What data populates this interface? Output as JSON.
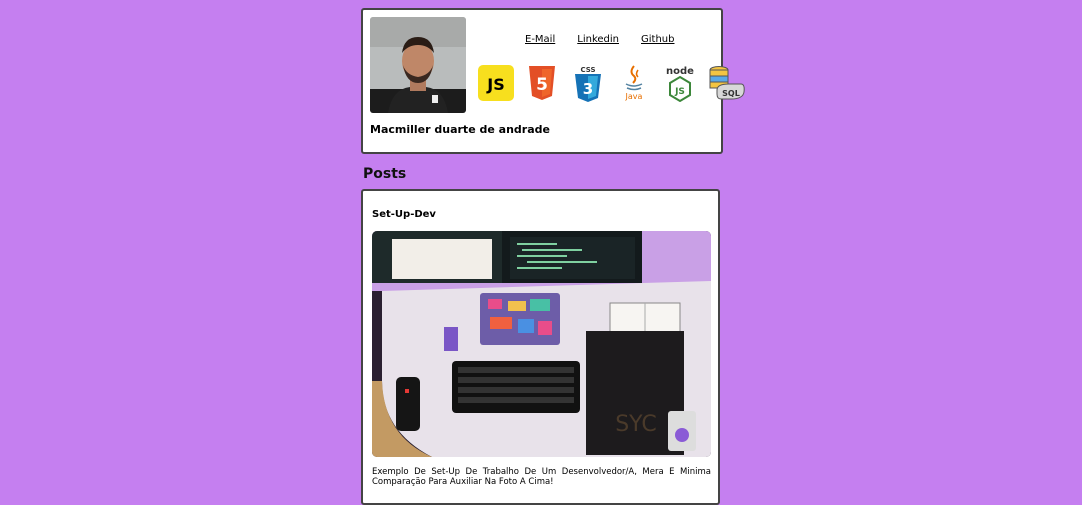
{
  "profile": {
    "name": "Macmiller duarte de andrade",
    "links": [
      "E-Mail",
      "Linkedin",
      "Github"
    ],
    "tech_icons": [
      {
        "name": "js-icon",
        "label": "JS",
        "color": "#f7df1e"
      },
      {
        "name": "html5-icon",
        "label": "5",
        "color": "#e34f26"
      },
      {
        "name": "css3-icon",
        "label": "CSS",
        "color": "#1572b6"
      },
      {
        "name": "java-icon",
        "label": "Java",
        "color": "#e76f00"
      },
      {
        "name": "nodejs-icon",
        "label": "node",
        "color": "#3c873a"
      },
      {
        "name": "sql-database-icon",
        "label": "SQL",
        "color": "#d9a21b"
      }
    ]
  },
  "posts": {
    "section_title": "Posts",
    "items": [
      {
        "title": "Set-Up-Dev",
        "description": "Exemplo De Set-Up De Trabalho De Um Desenvolvedor/A, Mera E Minima Comparação Para Auxiliar Na Foto A Cima!"
      }
    ]
  },
  "colors": {
    "background": "#c57ff0",
    "card": "#ffffff",
    "border": "#444444"
  }
}
